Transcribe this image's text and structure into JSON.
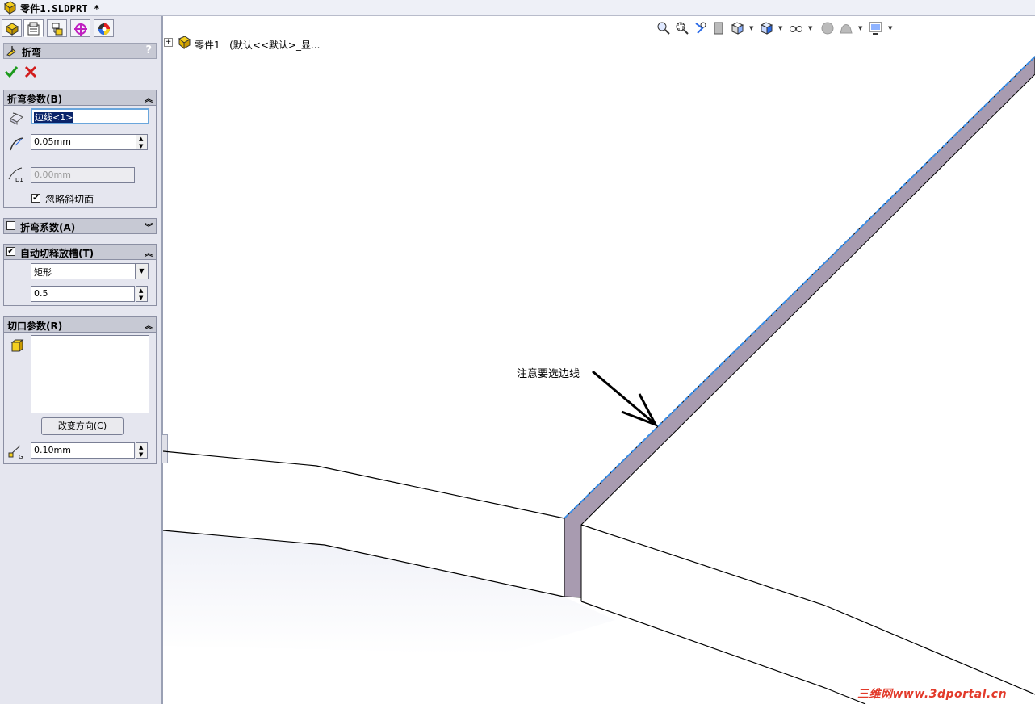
{
  "window": {
    "title": "零件1.SLDPRT *"
  },
  "property_manager": {
    "title": "折弯",
    "help": "?",
    "bend_params": {
      "header": "折弯参数(B)",
      "edge_value": "边线<1>",
      "radius_value": "0.05mm",
      "offset_value": "0.00mm",
      "ignore_bevel_label": "忽略斜切面",
      "ignore_bevel_checked": true
    },
    "bend_allowance": {
      "header": "折弯系数(A)",
      "checked": false
    },
    "auto_relief": {
      "header": "自动切释放槽(T)",
      "checked": true,
      "type_value": "矩形",
      "ratio_value": "0.5"
    },
    "gap_params": {
      "header": "切口参数(R)",
      "reverse_label": "改变方向(C)",
      "gap_value": "0.10mm"
    }
  },
  "feature_tree": {
    "part_name": "零件1",
    "config": "(默认<<默认>_显..."
  },
  "annotation": "注意要选边线",
  "watermark": "三维网www.3dportal.cn",
  "colors": {
    "selected_edge": "#3a8fe8",
    "thickness_face": "#a89bb0",
    "title_bg": "#eef0f7",
    "panel_bg": "#e5e6ef"
  }
}
